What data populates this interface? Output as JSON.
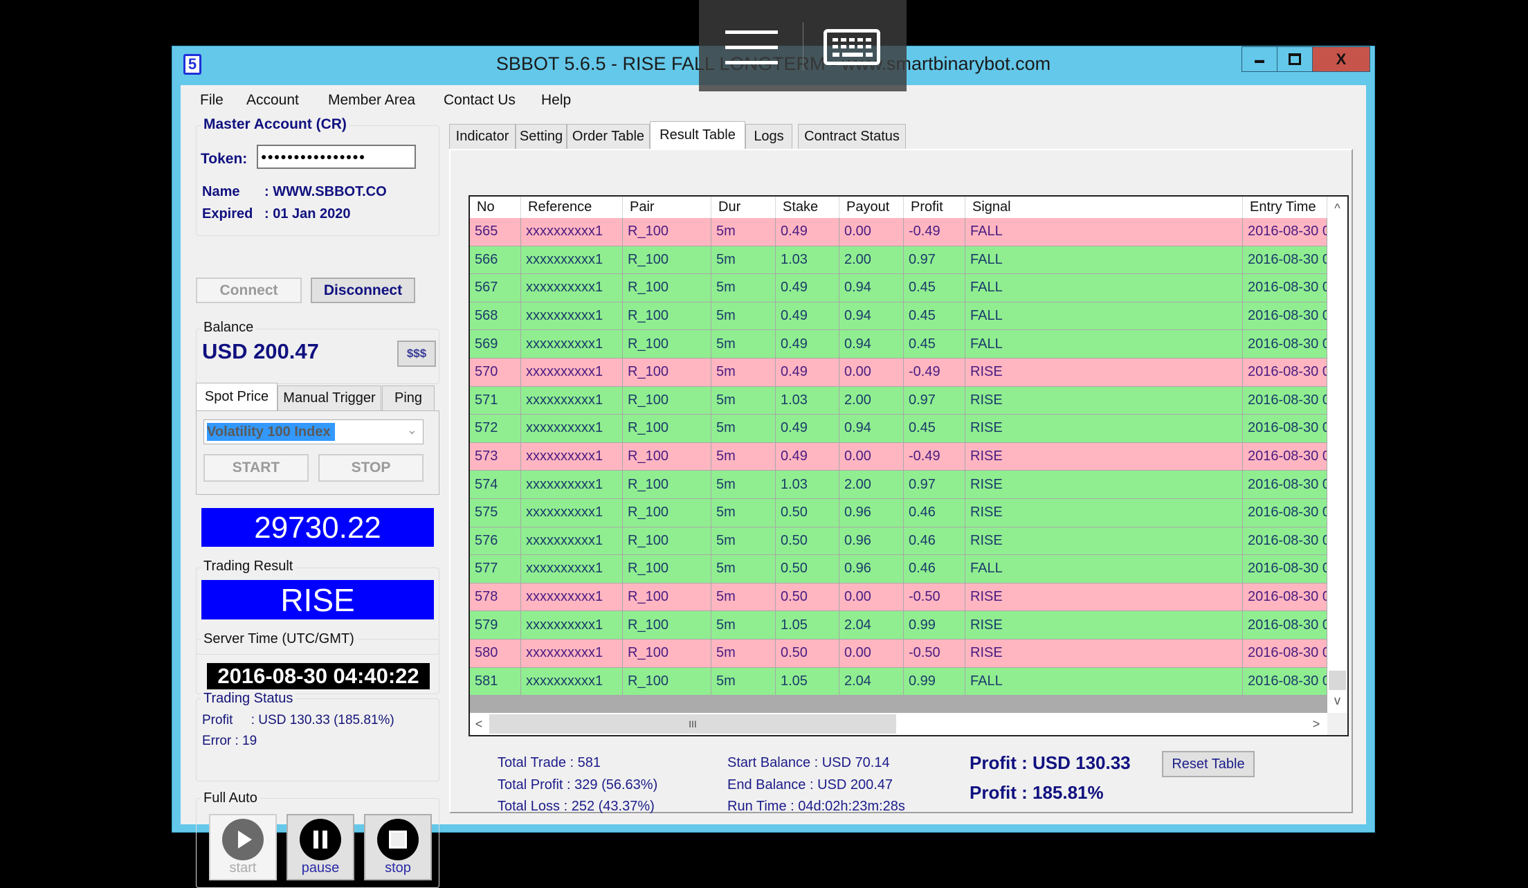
{
  "window": {
    "title": "SBBOT 5.6.5 - RISE FALL LONGTERM - www.smartbinarybot.com",
    "icon_label": "5",
    "minimize": "▬",
    "maximize": "□",
    "close": "X"
  },
  "menu": [
    "File",
    "Account",
    "Member Area",
    "Contact Us",
    "Help"
  ],
  "account": {
    "group_title": "Master Account (CR)",
    "token_label": "Token:",
    "token_value": "●●●●●●●●●●●●●●●●",
    "name_label": "Name",
    "name_value": ": WWW.SBBOT.CO",
    "expired_label": "Expired",
    "expired_value": ": 01 Jan 2020",
    "connect": "Connect",
    "disconnect": "Disconnect"
  },
  "balance": {
    "group_title": "Balance",
    "value": "USD 200.47",
    "button": "$$$"
  },
  "spot_tabs": [
    "Spot Price",
    "Manual Trigger",
    "Ping"
  ],
  "spot": {
    "selected_market": "Volatility 100 Index",
    "start": "START",
    "stop": "STOP",
    "price": "29730.22"
  },
  "trading_result": {
    "group_title": "Trading Result",
    "value": "RISE"
  },
  "server_time": {
    "group_title": "Server Time (UTC/GMT)",
    "value": "2016-08-30 04:40:22"
  },
  "trading_status": {
    "group_title": "Trading Status",
    "profit_line": "Profit     : USD 130.33 (185.81%)",
    "error_line": "Error : 19"
  },
  "full_auto": {
    "group_title": "Full Auto",
    "start": "start",
    "pause": "pause",
    "stop": "stop"
  },
  "main_tabs": [
    "Indicator",
    "Setting",
    "Order Table",
    "Result Table",
    "Logs",
    "Contract Status"
  ],
  "active_tab": "Result Table",
  "table": {
    "columns": [
      "No",
      "Reference",
      "Pair",
      "Dur",
      "Stake",
      "Payout",
      "Profit",
      "Signal",
      "Entry Time"
    ],
    "rows": [
      {
        "no": "565",
        "ref": "xxxxxxxxxx1",
        "pair": "R_100",
        "dur": "5m",
        "stake": "0.49",
        "payout": "0.00",
        "profit": "-0.49",
        "signal": "FALL",
        "entry": "2016-08-30 0",
        "result": "loss"
      },
      {
        "no": "566",
        "ref": "xxxxxxxxxx1",
        "pair": "R_100",
        "dur": "5m",
        "stake": "1.03",
        "payout": "2.00",
        "profit": "0.97",
        "signal": "FALL",
        "entry": "2016-08-30 0",
        "result": "win"
      },
      {
        "no": "567",
        "ref": "xxxxxxxxxx1",
        "pair": "R_100",
        "dur": "5m",
        "stake": "0.49",
        "payout": "0.94",
        "profit": "0.45",
        "signal": "FALL",
        "entry": "2016-08-30 0",
        "result": "win"
      },
      {
        "no": "568",
        "ref": "xxxxxxxxxx1",
        "pair": "R_100",
        "dur": "5m",
        "stake": "0.49",
        "payout": "0.94",
        "profit": "0.45",
        "signal": "FALL",
        "entry": "2016-08-30 0",
        "result": "win"
      },
      {
        "no": "569",
        "ref": "xxxxxxxxxx1",
        "pair": "R_100",
        "dur": "5m",
        "stake": "0.49",
        "payout": "0.94",
        "profit": "0.45",
        "signal": "FALL",
        "entry": "2016-08-30 0",
        "result": "win"
      },
      {
        "no": "570",
        "ref": "xxxxxxxxxx1",
        "pair": "R_100",
        "dur": "5m",
        "stake": "0.49",
        "payout": "0.00",
        "profit": "-0.49",
        "signal": "RISE",
        "entry": "2016-08-30 0",
        "result": "loss"
      },
      {
        "no": "571",
        "ref": "xxxxxxxxxx1",
        "pair": "R_100",
        "dur": "5m",
        "stake": "1.03",
        "payout": "2.00",
        "profit": "0.97",
        "signal": "RISE",
        "entry": "2016-08-30 0",
        "result": "win"
      },
      {
        "no": "572",
        "ref": "xxxxxxxxxx1",
        "pair": "R_100",
        "dur": "5m",
        "stake": "0.49",
        "payout": "0.94",
        "profit": "0.45",
        "signal": "RISE",
        "entry": "2016-08-30 0",
        "result": "win"
      },
      {
        "no": "573",
        "ref": "xxxxxxxxxx1",
        "pair": "R_100",
        "dur": "5m",
        "stake": "0.49",
        "payout": "0.00",
        "profit": "-0.49",
        "signal": "RISE",
        "entry": "2016-08-30 0",
        "result": "loss"
      },
      {
        "no": "574",
        "ref": "xxxxxxxxxx1",
        "pair": "R_100",
        "dur": "5m",
        "stake": "1.03",
        "payout": "2.00",
        "profit": "0.97",
        "signal": "RISE",
        "entry": "2016-08-30 0",
        "result": "win"
      },
      {
        "no": "575",
        "ref": "xxxxxxxxxx1",
        "pair": "R_100",
        "dur": "5m",
        "stake": "0.50",
        "payout": "0.96",
        "profit": "0.46",
        "signal": "RISE",
        "entry": "2016-08-30 0",
        "result": "win"
      },
      {
        "no": "576",
        "ref": "xxxxxxxxxx1",
        "pair": "R_100",
        "dur": "5m",
        "stake": "0.50",
        "payout": "0.96",
        "profit": "0.46",
        "signal": "RISE",
        "entry": "2016-08-30 0",
        "result": "win"
      },
      {
        "no": "577",
        "ref": "xxxxxxxxxx1",
        "pair": "R_100",
        "dur": "5m",
        "stake": "0.50",
        "payout": "0.96",
        "profit": "0.46",
        "signal": "FALL",
        "entry": "2016-08-30 0",
        "result": "win"
      },
      {
        "no": "578",
        "ref": "xxxxxxxxxx1",
        "pair": "R_100",
        "dur": "5m",
        "stake": "0.50",
        "payout": "0.00",
        "profit": "-0.50",
        "signal": "RISE",
        "entry": "2016-08-30 0",
        "result": "loss"
      },
      {
        "no": "579",
        "ref": "xxxxxxxxxx1",
        "pair": "R_100",
        "dur": "5m",
        "stake": "1.05",
        "payout": "2.04",
        "profit": "0.99",
        "signal": "RISE",
        "entry": "2016-08-30 0",
        "result": "win"
      },
      {
        "no": "580",
        "ref": "xxxxxxxxxx1",
        "pair": "R_100",
        "dur": "5m",
        "stake": "0.50",
        "payout": "0.00",
        "profit": "-0.50",
        "signal": "RISE",
        "entry": "2016-08-30 0",
        "result": "loss"
      },
      {
        "no": "581",
        "ref": "xxxxxxxxxx1",
        "pair": "R_100",
        "dur": "5m",
        "stake": "1.05",
        "payout": "2.04",
        "profit": "0.99",
        "signal": "FALL",
        "entry": "2016-08-30 0",
        "result": "win"
      }
    ],
    "scroll_up": "^",
    "scroll_down": "v",
    "scroll_left": "<",
    "scroll_right": ">",
    "hscroll_grip": "III"
  },
  "summary": {
    "total_trade": "Total Trade : 581",
    "total_profit": "Total Profit : 329 (56.63%)",
    "total_loss": "Total Loss : 252 (43.37%)",
    "start_balance": "Start Balance : USD 70.14",
    "end_balance": "End Balance : USD 200.47",
    "run_time": "Run Time : 04d:02h:23m:28s",
    "profit_usd": "Profit : USD 130.33",
    "profit_pct": "Profit : 185.81%",
    "reset_table": "Reset Table"
  },
  "colors": {
    "win_row": "#90ee90",
    "loss_row": "#ffb6c1",
    "display_blue": "#0000ff",
    "titlebar": "#64c8ea",
    "close_button": "#c7544b"
  }
}
